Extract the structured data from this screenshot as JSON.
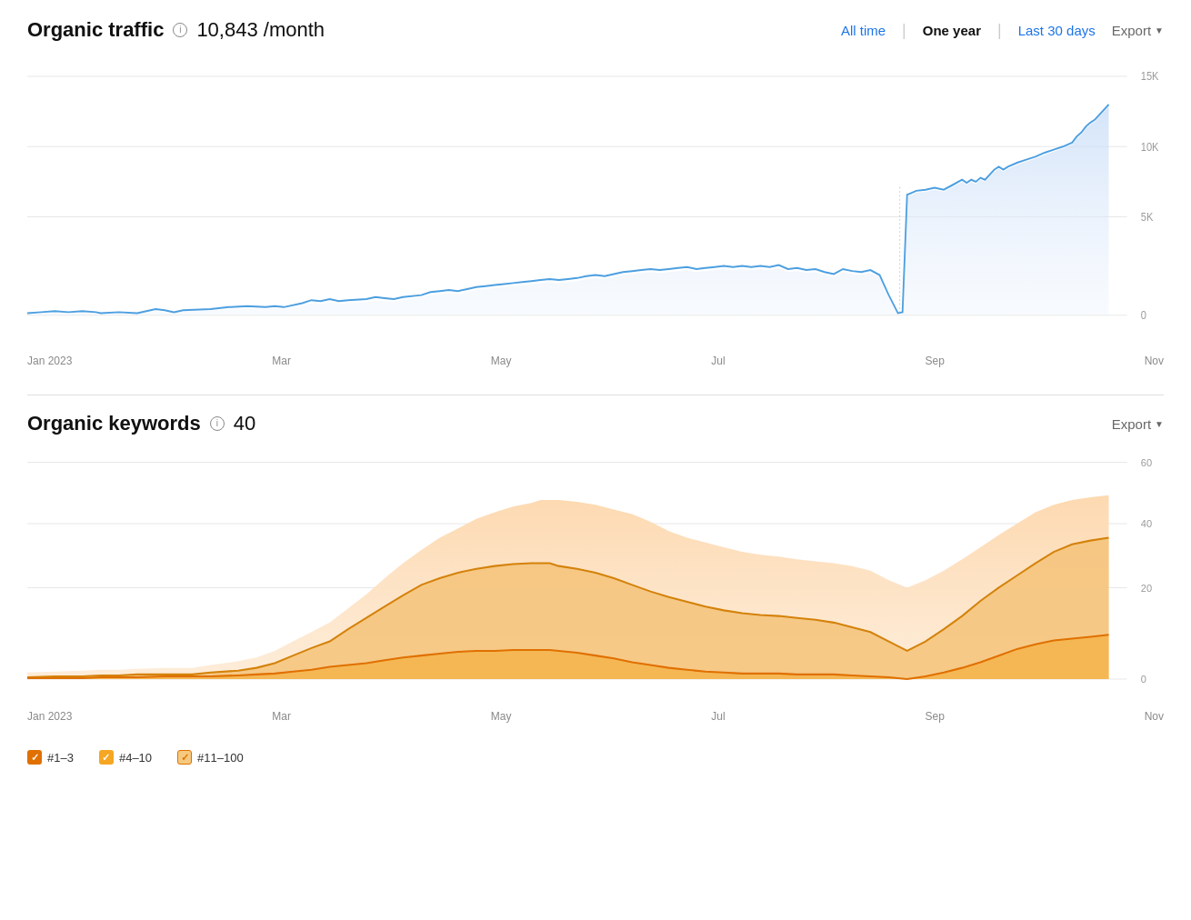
{
  "organic_traffic": {
    "title": "Organic traffic",
    "metric": "10,843",
    "unit": "/month",
    "info_icon": "i",
    "time_filters": [
      {
        "label": "All time",
        "active": false
      },
      {
        "label": "One year",
        "active": true
      },
      {
        "label": "Last 30 days",
        "active": false
      }
    ],
    "export_label": "Export",
    "y_axis": {
      "top": "15K",
      "mid": "10K",
      "mid2": "5K",
      "bottom": "0"
    },
    "x_axis": [
      "Jan 2023",
      "Mar",
      "May",
      "Jul",
      "Sep",
      "Nov"
    ]
  },
  "organic_keywords": {
    "title": "Organic keywords",
    "count": "40",
    "info_icon": "i",
    "export_label": "Export",
    "y_axis": {
      "top": "60",
      "mid": "40",
      "mid2": "20",
      "bottom": "0"
    },
    "x_axis": [
      "Jan 2023",
      "Mar",
      "May",
      "Jul",
      "Sep",
      "Nov"
    ]
  },
  "legend": [
    {
      "label": "#1–3",
      "color_class": "cb-orange-dark"
    },
    {
      "label": "#4–10",
      "color_class": "cb-orange"
    },
    {
      "label": "#11–100",
      "color_class": "cb-orange-light"
    }
  ]
}
